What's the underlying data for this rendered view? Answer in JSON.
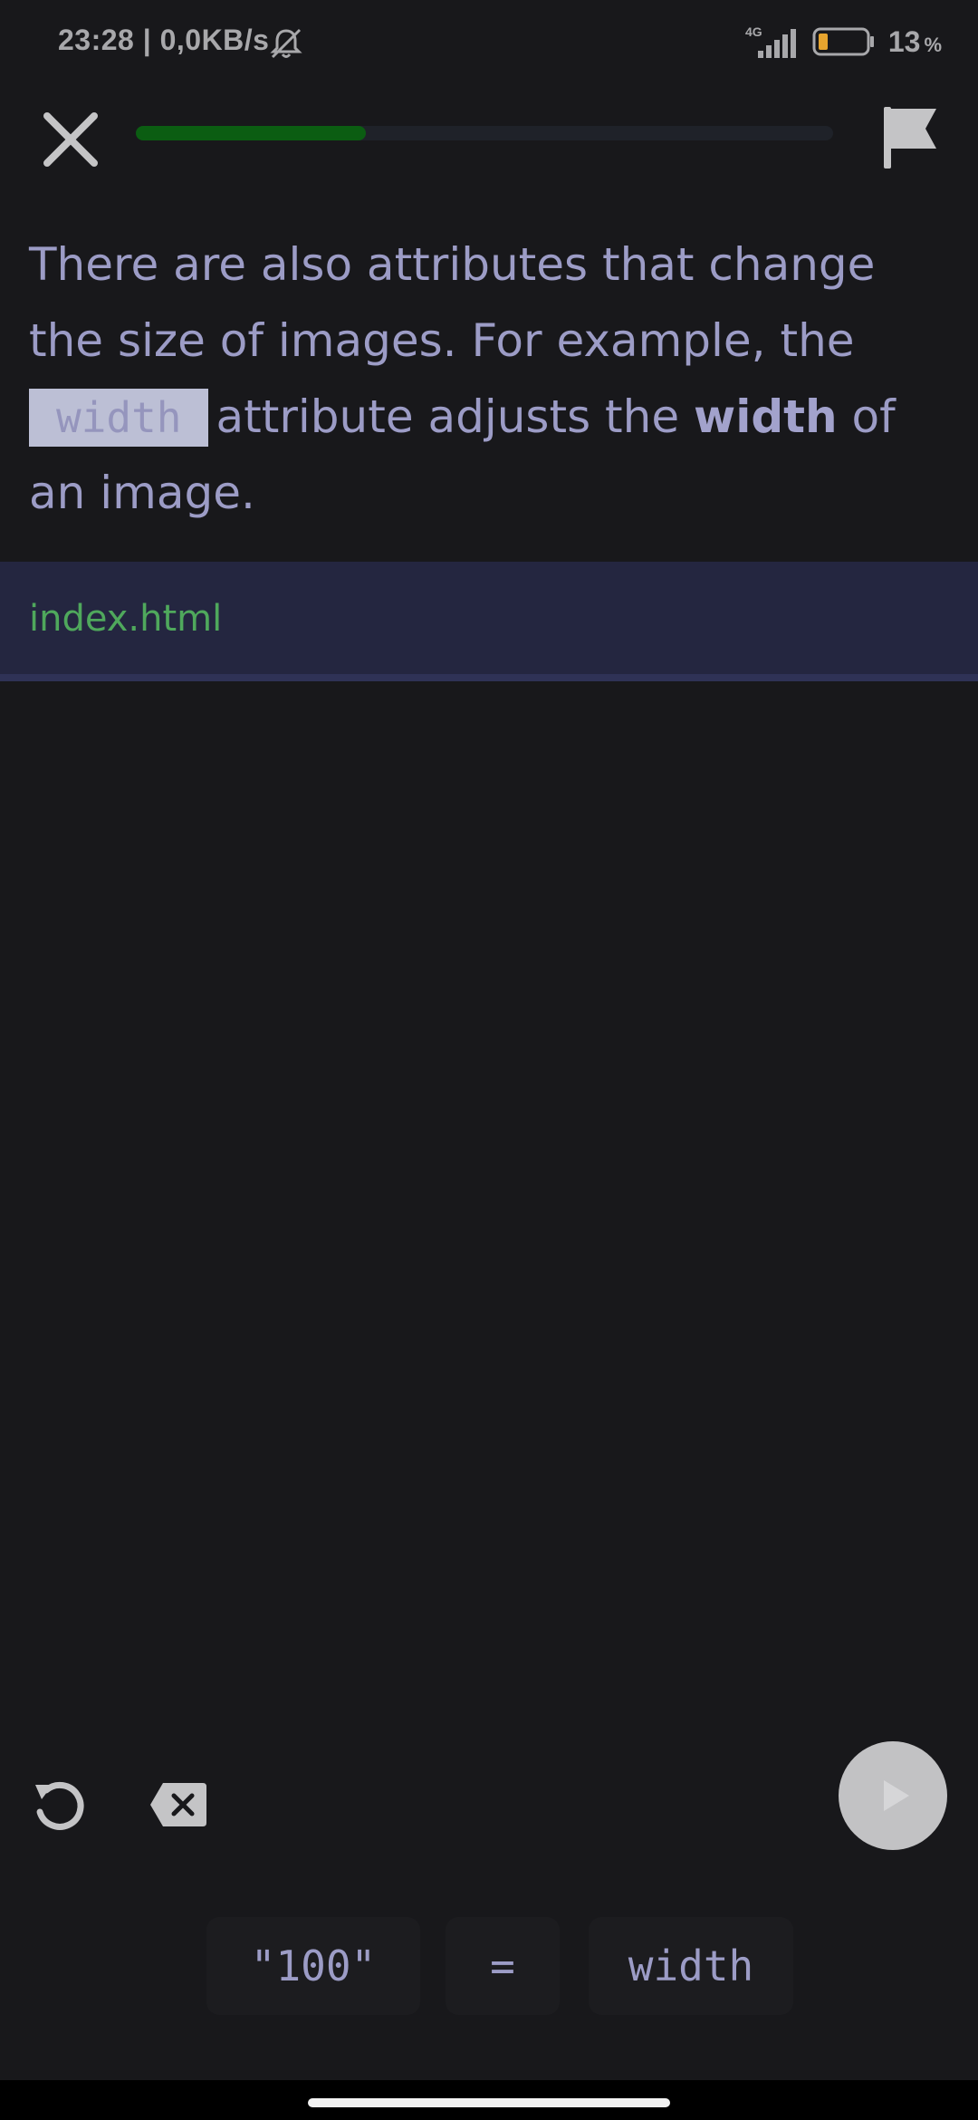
{
  "status_bar": {
    "time_speed": "23:28 | 0,0KB/s",
    "network": "4G",
    "battery_percent": "13",
    "battery_unit": "%",
    "battery_level": 0.13,
    "battery_color": "#e6a42e"
  },
  "top_bar": {
    "progress": 0.33,
    "progress_color": "#0b5d12"
  },
  "lesson": {
    "text_before": "There are also attributes that change the size of images. For example, the",
    "code": "width",
    "text_middle": "attribute adjusts the",
    "bold": "width",
    "text_after": "of an image."
  },
  "file_tab": {
    "name": "index.html",
    "color": "#4fa85c"
  },
  "controls": {
    "reset_icon": "reset-icon",
    "backspace_icon": "backspace-icon",
    "run_icon": "play-icon"
  },
  "tokens": [
    "\"100\"",
    "=",
    "width"
  ]
}
